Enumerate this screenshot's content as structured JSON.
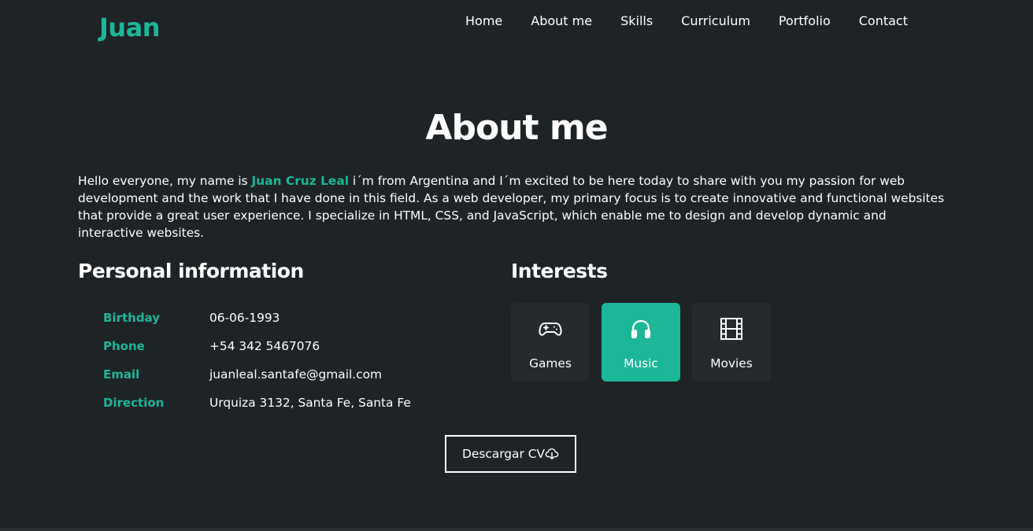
{
  "header": {
    "logo": "Juan",
    "nav": [
      "Home",
      "About me",
      "Skills",
      "Curriculum",
      "Portfolio",
      "Contact"
    ]
  },
  "about": {
    "title": "About me",
    "intro_before": "Hello everyone, my name is ",
    "intro_name": "Juan Cruz Leal",
    "intro_after": " i´m from Argentina and I´m excited to be here today to share with you my passion for web development and the work that I have done in this field. As a web developer, my primary focus is to create innovative and functional websites that provide a great user experience. I specialize in HTML, CSS, and JavaScript, which enable me to design and develop dynamic and interactive websites."
  },
  "personal": {
    "title": "Personal information",
    "rows": [
      {
        "key": "Birthday",
        "value": "06-06-1993"
      },
      {
        "key": "Phone",
        "value": "+54 342 5467076"
      },
      {
        "key": "Email",
        "value": "juanleal.santafe@gmail.com"
      },
      {
        "key": "Direction",
        "value": "Urquiza 3132, Santa Fe, Santa Fe"
      }
    ]
  },
  "interests": {
    "title": "Interests",
    "items": [
      {
        "label": "Games",
        "icon": "gamepad-icon",
        "active": false
      },
      {
        "label": "Music",
        "icon": "headphones-icon",
        "active": true
      },
      {
        "label": "Movies",
        "icon": "film-icon",
        "active": false
      }
    ]
  },
  "cv_button": {
    "label": "Descargar CV",
    "icon": "cloud-download-icon"
  },
  "colors": {
    "background": "#1e2326",
    "accent": "#1cb698",
    "card": "#252a2e",
    "text": "#ffffff"
  }
}
